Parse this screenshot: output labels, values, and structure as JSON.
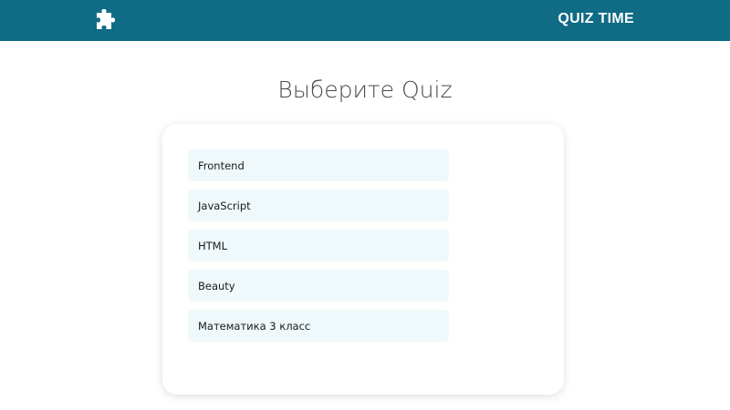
{
  "header": {
    "logo_icon": "puzzle-icon",
    "brand": "QUIZ TIME",
    "background_color": "#106b85"
  },
  "main": {
    "title": "Выберите Quiz",
    "quizzes": [
      {
        "label": "Frontend"
      },
      {
        "label": "JavaScript"
      },
      {
        "label": "HTML"
      },
      {
        "label": "Beauty"
      },
      {
        "label": "Математика 3 класс"
      }
    ]
  }
}
